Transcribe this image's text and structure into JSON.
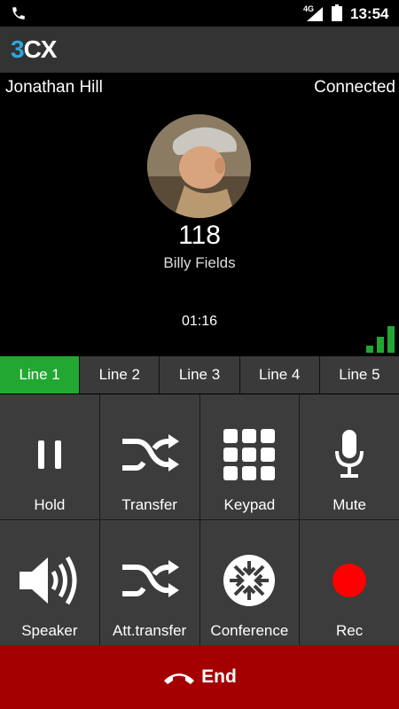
{
  "status_bar": {
    "network": "4G",
    "time": "13:54",
    "icons": [
      "phone-icon",
      "signal-icon",
      "battery-icon"
    ]
  },
  "app": {
    "logo_3": "3",
    "logo_cx": "CX"
  },
  "call": {
    "caller_name": "Jonathan Hill",
    "status": "Connected",
    "extension": "118",
    "contact_name": "Billy Fields",
    "duration": "01:16"
  },
  "lines": [
    {
      "label": "Line 1",
      "active": true
    },
    {
      "label": "Line 2",
      "active": false
    },
    {
      "label": "Line 3",
      "active": false
    },
    {
      "label": "Line 4",
      "active": false
    },
    {
      "label": "Line 5",
      "active": false
    }
  ],
  "actions": {
    "hold": "Hold",
    "transfer": "Transfer",
    "keypad": "Keypad",
    "mute": "Mute",
    "speaker": "Speaker",
    "att_transfer": "Att.transfer",
    "conference": "Conference",
    "rec": "Rec"
  },
  "end": {
    "label": "End"
  },
  "colors": {
    "active_line": "#22a832",
    "end_bar": "#a40000",
    "record": "#ff0000",
    "logo_accent": "#2aa7df"
  }
}
